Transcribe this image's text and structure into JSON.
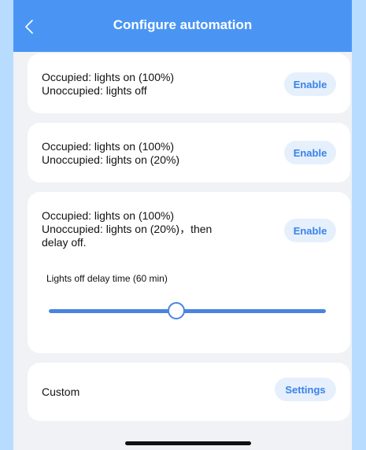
{
  "header": {
    "title": "Configure automation",
    "back_icon": "chevron-left-icon"
  },
  "options": [
    {
      "line1": "Occupied: lights on (100%)",
      "line2": "Unoccupied: lights off",
      "action": "Enable"
    },
    {
      "line1": "Occupied: lights on (100%)",
      "line2": "Unoccupied: lights on (20%)",
      "action": "Enable"
    },
    {
      "line1": "Occupied: lights on (100%)",
      "line2": "Unoccupied: lights on (20%)，then",
      "line3": "delay off.",
      "action": "Enable",
      "slider_label": "Lights off delay time (60 min)",
      "slider_fraction": 0.46
    },
    {
      "label": "Custom",
      "action": "Settings"
    }
  ],
  "colors": {
    "accent": "#4a95f4",
    "pill_background": "#e6f0fd",
    "pill_text": "#3a82ea",
    "page_background": "#f0f2f5",
    "slider": "#4a84e0"
  }
}
